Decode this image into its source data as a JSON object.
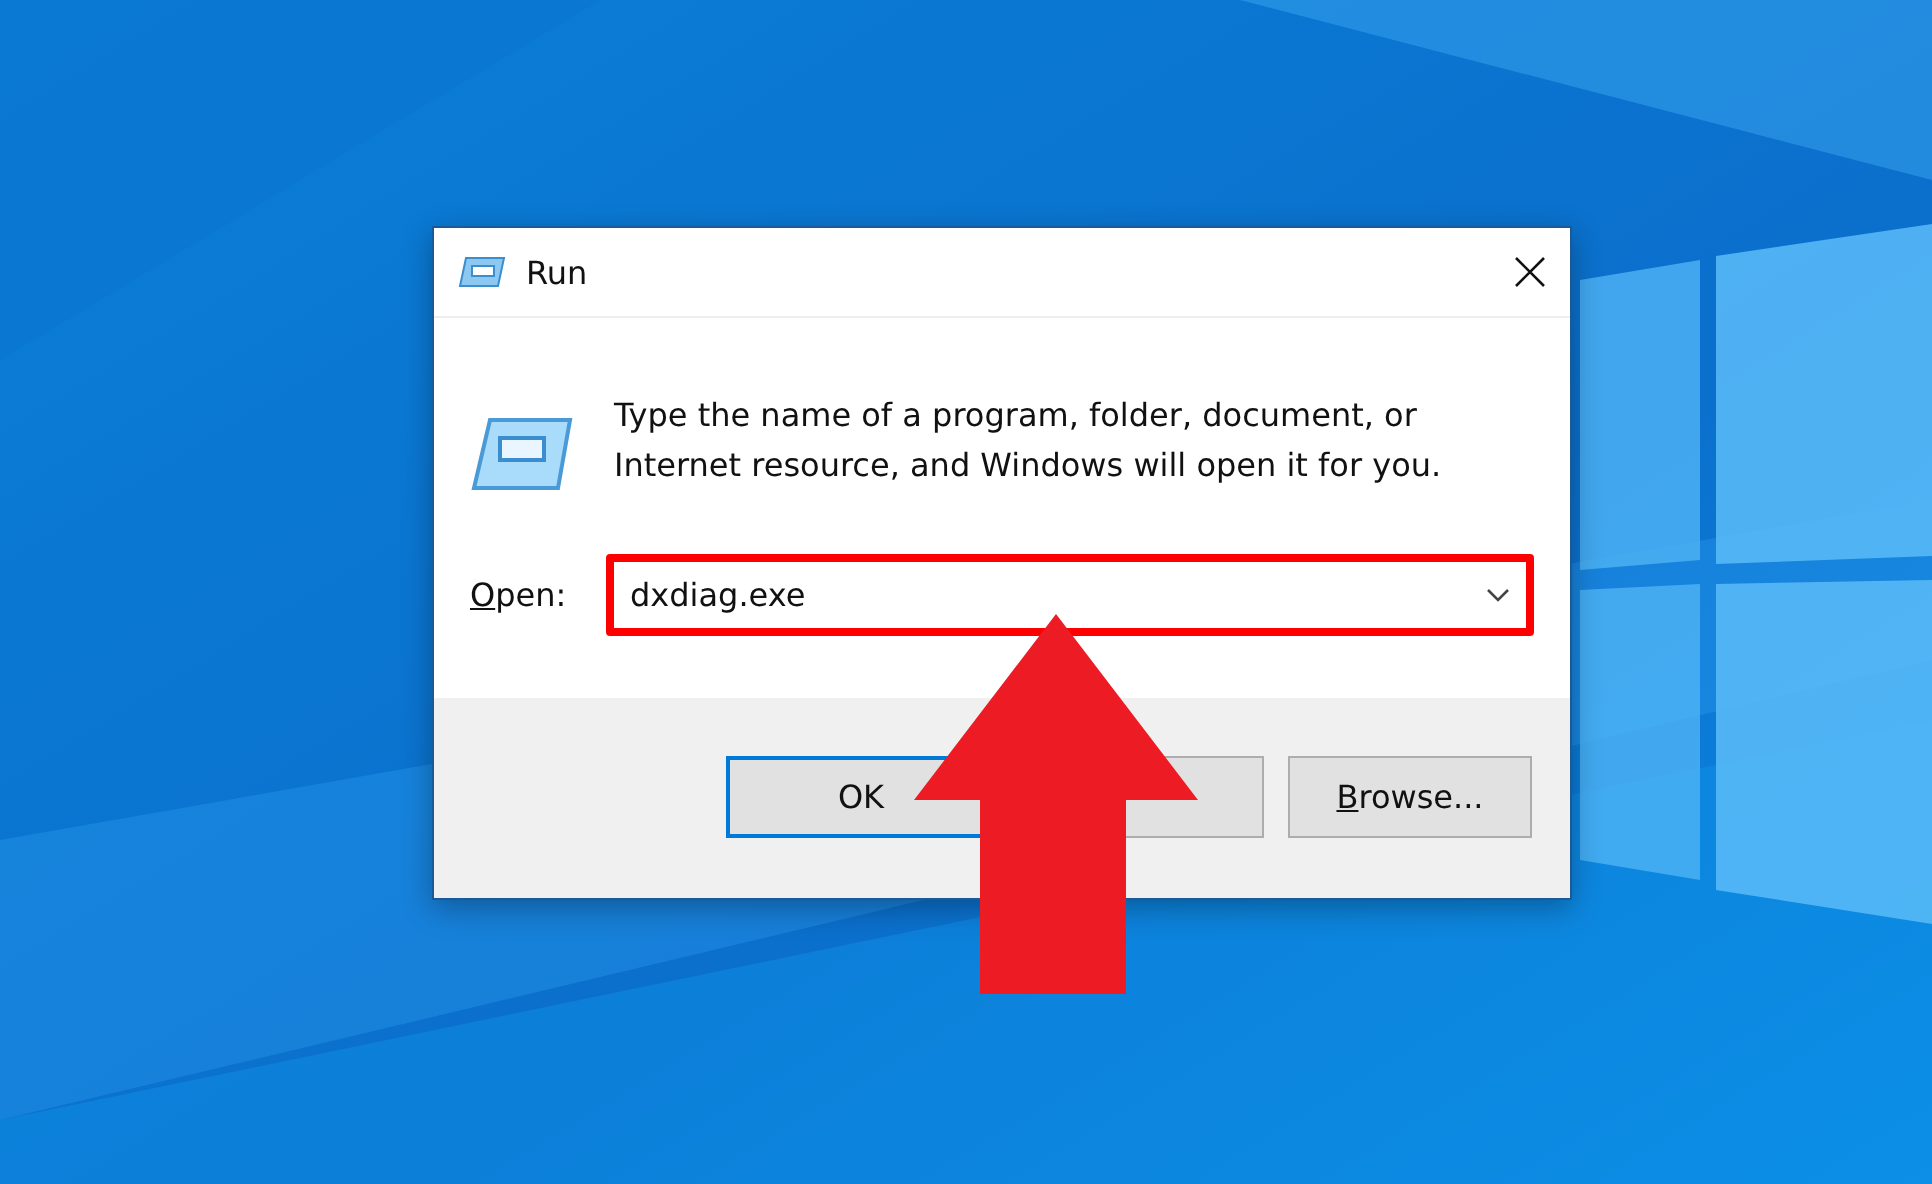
{
  "window": {
    "title": "Run"
  },
  "message": "Type the name of a program, folder, document, or Internet resource, and Windows will open it for you.",
  "open": {
    "label": {
      "key": "O",
      "rest": "pen:"
    },
    "value": "dxdiag.exe",
    "highlighted": true
  },
  "buttons": [
    {
      "kind": "text",
      "label": {
        "rest": "OK"
      },
      "default": true
    },
    {
      "kind": "covered",
      "default": false
    },
    {
      "kind": "text",
      "label": {
        "key": "B",
        "rest": "rowse..."
      },
      "default": false
    }
  ],
  "annotation": {
    "kind": "up-arrow"
  }
}
